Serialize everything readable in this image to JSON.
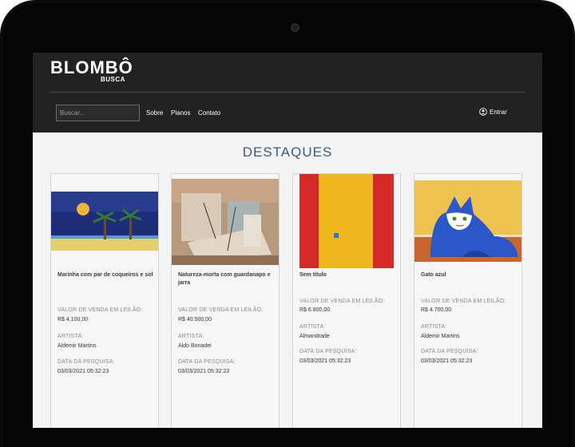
{
  "app": {
    "logo": "BLOMBÔ",
    "logo_sub": "BUSCA"
  },
  "nav": {
    "search_placeholder": "Buscar...",
    "links": [
      "Sobre",
      "Planos",
      "Contato"
    ],
    "login": "Entrar"
  },
  "section_title": "DESTAQUES",
  "labels": {
    "price": "VALOR DE VENDA EM LEILÃO:",
    "artist": "ARTISTA:",
    "date": "DATA DA PESQUISA:"
  },
  "cards": [
    {
      "title": "Marinha com par de coqueiros e sol",
      "price": "R$ 4.100,00",
      "artist": "Aldemir Martins",
      "date": "03/03/2021 05:32:23"
    },
    {
      "title": "Natureza-morta com guardanapo e jarra",
      "price": "R$ 40.500,00",
      "artist": "Aldo Bonadei",
      "date": "03/03/2021 05:32:23"
    },
    {
      "title": "Sem título",
      "price": "R$ 6.800,00",
      "artist": "Almandrade",
      "date": "03/03/2021 05:32:23"
    },
    {
      "title": "Gato azul",
      "price": "R$ 4.700,00",
      "artist": "Aldemir Martins",
      "date": "03/03/2021 05:32:23"
    }
  ]
}
